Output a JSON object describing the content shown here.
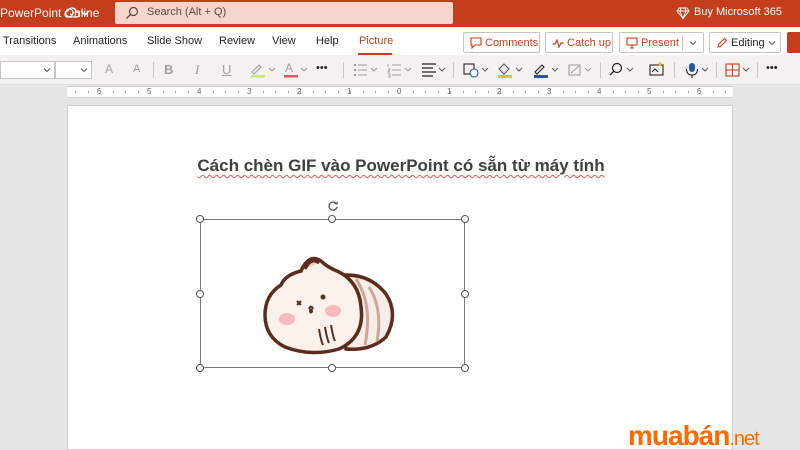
{
  "titlebar": {
    "app_title": "PowerPoint Online",
    "search_placeholder": "Search (Alt + Q)",
    "buy_label": "Buy Microsoft 365"
  },
  "tabs": [
    {
      "label": "Transitions"
    },
    {
      "label": "Animations"
    },
    {
      "label": "Slide Show"
    },
    {
      "label": "Review"
    },
    {
      "label": "View"
    },
    {
      "label": "Help"
    },
    {
      "label": "Picture",
      "active": true
    }
  ],
  "ribbon_buttons": {
    "comments": "Comments",
    "catch_up": "Catch up",
    "present": "Present",
    "editing": "Editing"
  },
  "toolbar": {
    "font_grow": "A",
    "font_shrink": "A",
    "bold": "B",
    "italic": "I",
    "underline": "U",
    "font_color": "A",
    "more": "•••"
  },
  "ruler": {
    "left_ticks": [
      "6",
      "5",
      "4",
      "3",
      "2",
      "1",
      "0"
    ],
    "right_ticks": [
      "1",
      "2",
      "3",
      "4",
      "5",
      "6"
    ]
  },
  "slide": {
    "title": "Cách chèn GIF vào PowerPoint có sẵn từ máy tính"
  },
  "watermark": {
    "brand": "muabán",
    "suffix": ".net"
  },
  "colors": {
    "accent": "#c43e1c",
    "watermark": "#ff6a00"
  }
}
